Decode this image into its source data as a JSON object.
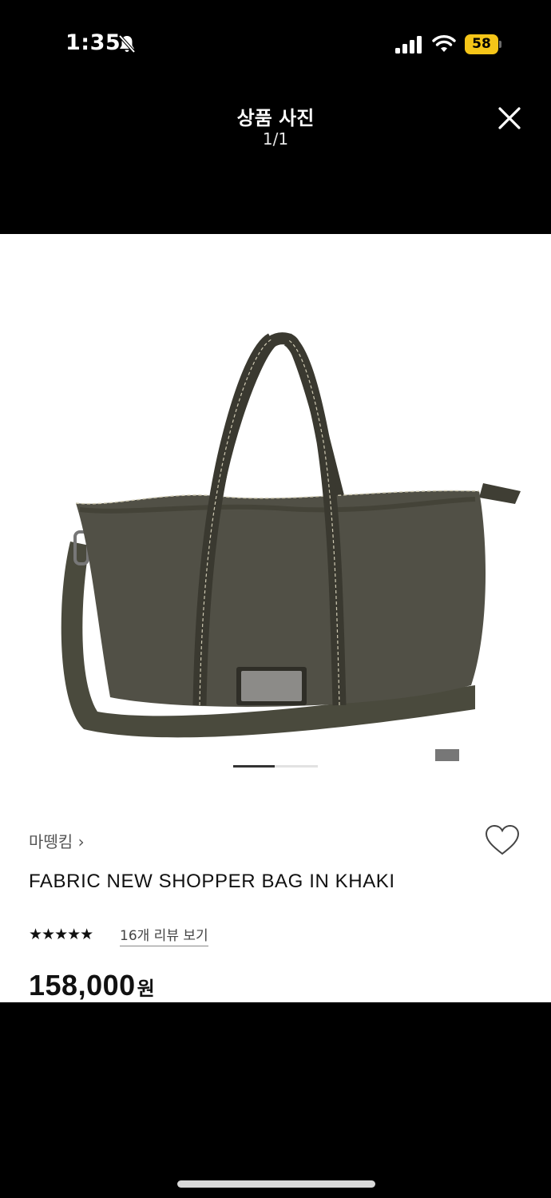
{
  "status_bar": {
    "time": "1:35",
    "battery": "58",
    "battery_color": "#f5c518",
    "icons": [
      "bell-slash-icon",
      "signal-icon",
      "wifi-icon",
      "battery-icon"
    ]
  },
  "viewer": {
    "title": "상품 사진",
    "counter": "1/1",
    "close_icon": "close-icon"
  },
  "product": {
    "brand": "마뗑킴",
    "brand_chevron": "›",
    "name": "FABRIC NEW SHOPPER BAG IN KHAKI",
    "rating_stars": "★★★★★",
    "review_link": "16개 리뷰 보기",
    "price": "158,000",
    "currency": "원",
    "wishlist_icon": "heart-outline-icon",
    "image_pager": {
      "current": 1,
      "total": 2
    }
  },
  "colors": {
    "bag_khaki": "#4c4b40",
    "background": "#000000",
    "panel": "#ffffff"
  }
}
